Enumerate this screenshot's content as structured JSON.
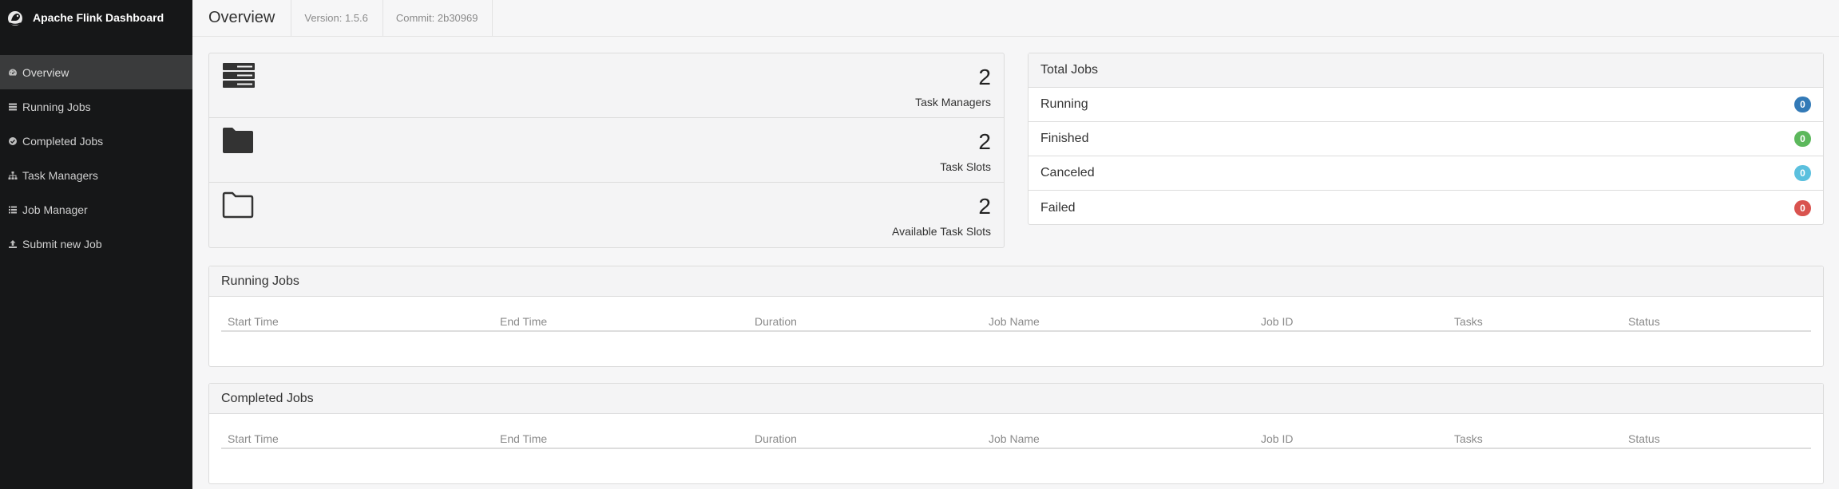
{
  "brand": {
    "title": "Apache Flink Dashboard"
  },
  "nav": [
    {
      "label": "Overview",
      "icon": "dashboard-icon",
      "active": true
    },
    {
      "label": "Running Jobs",
      "icon": "tasks-icon"
    },
    {
      "label": "Completed Jobs",
      "icon": "check-circle-icon"
    },
    {
      "label": "Task Managers",
      "icon": "sitemap-icon"
    },
    {
      "label": "Job Manager",
      "icon": "list-icon"
    },
    {
      "label": "Submit new Job",
      "icon": "upload-icon"
    }
  ],
  "header": {
    "title": "Overview",
    "version": "Version: 1.5.6",
    "commit": "Commit: 2b30969"
  },
  "stats": [
    {
      "value": "2",
      "label": "Task Managers",
      "icon": "server-icon"
    },
    {
      "value": "2",
      "label": "Task Slots",
      "icon": "folder-icon"
    },
    {
      "value": "2",
      "label": "Available Task Slots",
      "icon": "folder-open-icon"
    }
  ],
  "totals": {
    "title": "Total Jobs",
    "rows": [
      {
        "label": "Running",
        "count": "0",
        "color": "#337ab7"
      },
      {
        "label": "Finished",
        "count": "0",
        "color": "#5cb85c"
      },
      {
        "label": "Canceled",
        "count": "0",
        "color": "#5bc0de"
      },
      {
        "label": "Failed",
        "count": "0",
        "color": "#d9534f"
      }
    ]
  },
  "running_jobs": {
    "title": "Running Jobs",
    "columns": [
      "Start Time",
      "End Time",
      "Duration",
      "Job Name",
      "Job ID",
      "Tasks",
      "Status"
    ]
  },
  "completed_jobs": {
    "title": "Completed Jobs",
    "columns": [
      "Start Time",
      "End Time",
      "Duration",
      "Job Name",
      "Job ID",
      "Tasks",
      "Status"
    ]
  }
}
